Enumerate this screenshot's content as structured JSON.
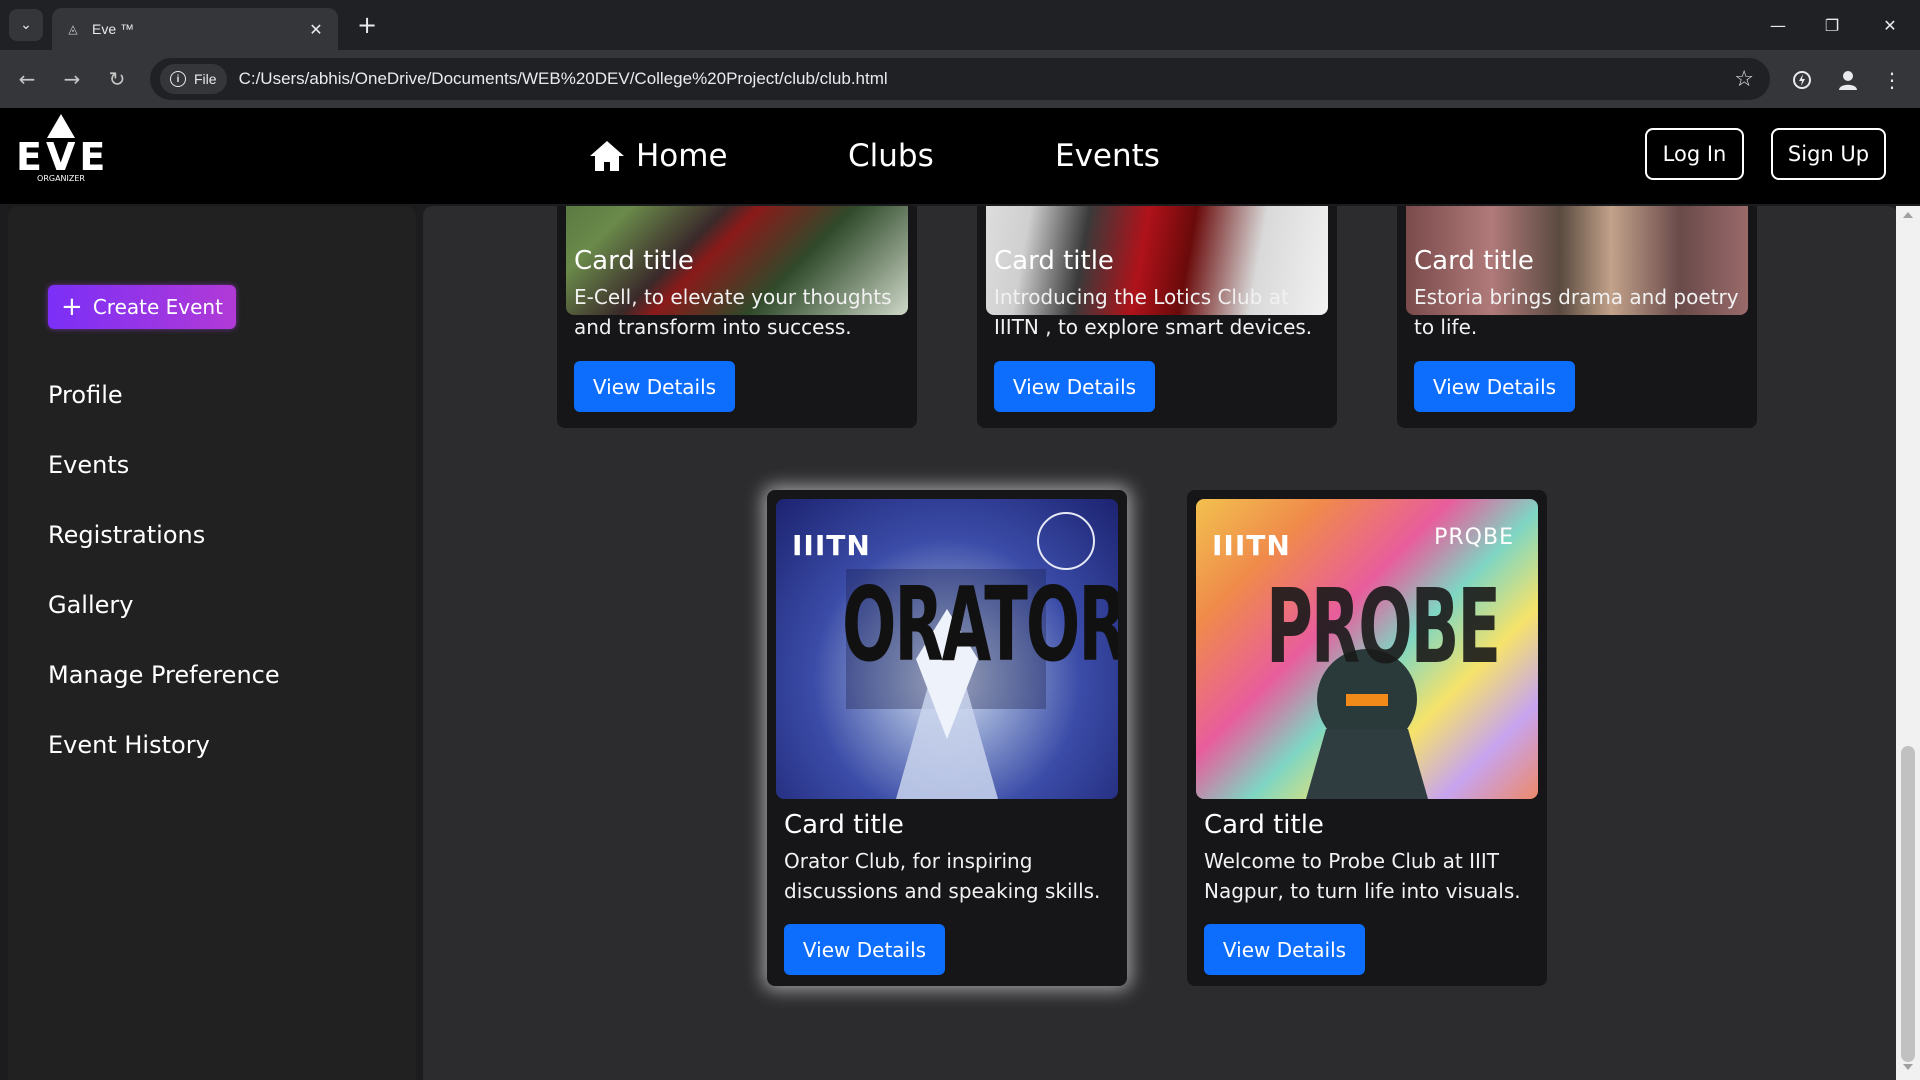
{
  "browser": {
    "tab_title": "Eve ™",
    "url_chip": "File",
    "url": "C:/Users/abhis/OneDrive/Documents/WEB%20DEV/College%20Project/club/club.html"
  },
  "site": {
    "logo_word": "EVE",
    "logo_sub": "ORGANIZER",
    "nav": {
      "home": "Home",
      "clubs": "Clubs",
      "events": "Events"
    },
    "login": "Log In",
    "signup": "Sign Up"
  },
  "sidebar": {
    "create": "Create Event",
    "items": [
      "Profile",
      "Events",
      "Registrations",
      "Gallery",
      "Manage Preference",
      "Event History"
    ]
  },
  "cards": [
    {
      "title": "Card title",
      "text": "E-Cell, to elevate your thoughts and transform into success.",
      "button": "View Details"
    },
    {
      "title": "Card title",
      "text": "Introducing the Lotics Club at IIITN , to explore smart devices.",
      "button": "View Details"
    },
    {
      "title": "Card title",
      "text": "Estoria brings drama and poetry to life.",
      "button": "View Details"
    },
    {
      "title": "Card title",
      "text": "Orator Club, for inspiring discussions and speaking skills.",
      "button": "View Details",
      "image_logo": "IIITN",
      "image_word": "ORATOR"
    },
    {
      "title": "Card title",
      "text": "Welcome to Probe Club at IIIT Nagpur, to turn life into visuals.",
      "button": "View Details",
      "image_logo": "IIITN",
      "image_word": "PROBE",
      "image_brand": "PRQBE"
    }
  ],
  "colors": {
    "primary_button": "#0d6efd",
    "create_gradient_start": "#7b2ff7",
    "create_gradient_end": "#b13ad6"
  }
}
